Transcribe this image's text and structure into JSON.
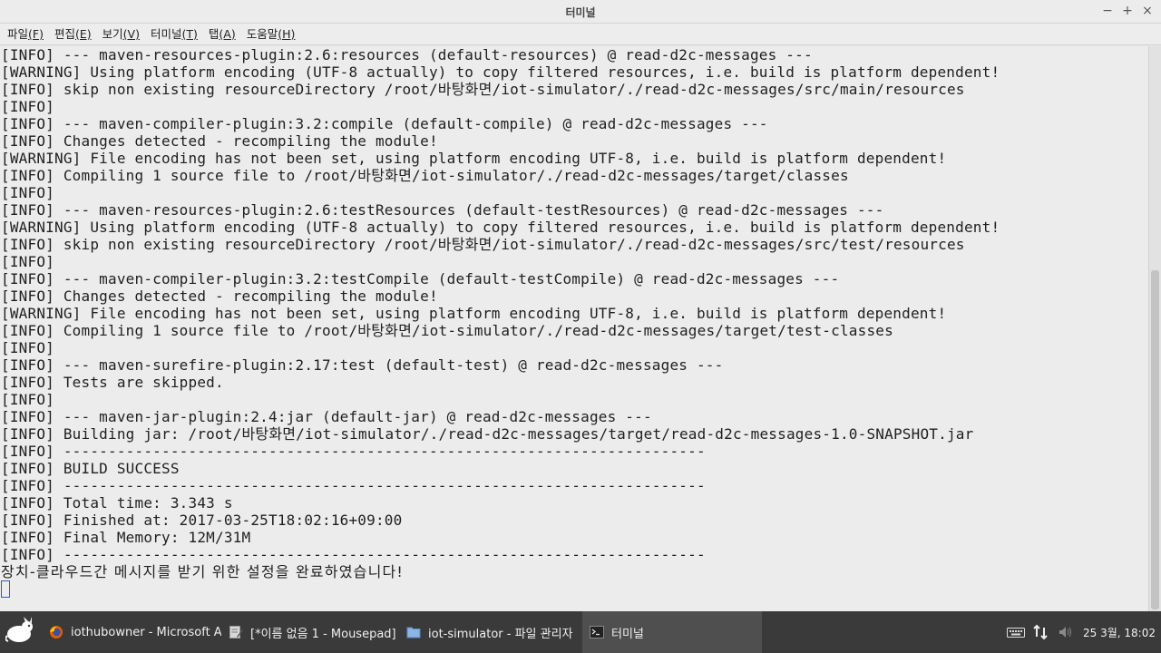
{
  "window": {
    "title": "터미널"
  },
  "window_buttons": {
    "minimize": "−",
    "maximize": "+",
    "close": "×"
  },
  "menu": [
    {
      "label": "파일",
      "mnemonic": "(F)"
    },
    {
      "label": "편집",
      "mnemonic": "(E)"
    },
    {
      "label": "보기",
      "mnemonic": "(V)"
    },
    {
      "label": "터미널",
      "mnemonic": "(T)"
    },
    {
      "label": "탭",
      "mnemonic": "(A)"
    },
    {
      "label": "도움말",
      "mnemonic": "(H)"
    }
  ],
  "terminal": {
    "lines": [
      "[INFO] --- maven-resources-plugin:2.6:resources (default-resources) @ read-d2c-messages ---",
      "[WARNING] Using platform encoding (UTF-8 actually) to copy filtered resources, i.e. build is platform dependent!",
      "[INFO] skip non existing resourceDirectory /root/바탕화면/iot-simulator/./read-d2c-messages/src/main/resources",
      "[INFO]",
      "[INFO] --- maven-compiler-plugin:3.2:compile (default-compile) @ read-d2c-messages ---",
      "[INFO] Changes detected - recompiling the module!",
      "[WARNING] File encoding has not been set, using platform encoding UTF-8, i.e. build is platform dependent!",
      "[INFO] Compiling 1 source file to /root/바탕화면/iot-simulator/./read-d2c-messages/target/classes",
      "[INFO]",
      "[INFO] --- maven-resources-plugin:2.6:testResources (default-testResources) @ read-d2c-messages ---",
      "[WARNING] Using platform encoding (UTF-8 actually) to copy filtered resources, i.e. build is platform dependent!",
      "[INFO] skip non existing resourceDirectory /root/바탕화면/iot-simulator/./read-d2c-messages/src/test/resources",
      "[INFO]",
      "[INFO] --- maven-compiler-plugin:3.2:testCompile (default-testCompile) @ read-d2c-messages ---",
      "[INFO] Changes detected - recompiling the module!",
      "[WARNING] File encoding has not been set, using platform encoding UTF-8, i.e. build is platform dependent!",
      "[INFO] Compiling 1 source file to /root/바탕화면/iot-simulator/./read-d2c-messages/target/test-classes",
      "[INFO]",
      "[INFO] --- maven-surefire-plugin:2.17:test (default-test) @ read-d2c-messages ---",
      "[INFO] Tests are skipped.",
      "[INFO]",
      "[INFO] --- maven-jar-plugin:2.4:jar (default-jar) @ read-d2c-messages ---",
      "[INFO] Building jar: /root/바탕화면/iot-simulator/./read-d2c-messages/target/read-d2c-messages-1.0-SNAPSHOT.jar",
      "[INFO] ------------------------------------------------------------------------",
      "[INFO] BUILD SUCCESS",
      "[INFO] ------------------------------------------------------------------------",
      "[INFO] Total time: 3.343 s",
      "[INFO] Finished at: 2017-03-25T18:02:16+09:00",
      "[INFO] Final Memory: 12M/31M",
      "[INFO] ------------------------------------------------------------------------"
    ],
    "message": "장치-클라우드간 메시지를 받기 위한 설정을 완료하였습니다!"
  },
  "taskbar": {
    "tasks": [
      {
        "label": "iothubowner - Microsoft Az...",
        "icon": "firefox-icon"
      },
      {
        "label": "[*이름 없음 1 - Mousepad]",
        "icon": "text-editor-icon"
      },
      {
        "label": "iot-simulator - 파일 관리자",
        "icon": "folder-icon"
      },
      {
        "label": "터미널",
        "icon": "terminal-icon",
        "active": true
      }
    ],
    "clock": "25 3월, 18:02"
  }
}
